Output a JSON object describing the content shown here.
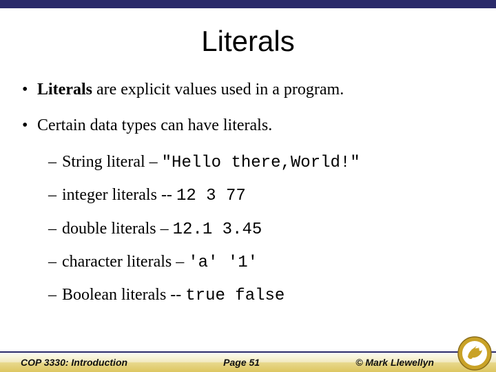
{
  "title": "Literals",
  "bullets": {
    "b1_strong": "Literals",
    "b1_rest": " are explicit values used in a program.",
    "b2": "Certain data types can have literals.",
    "sub1_lead": "String literal – ",
    "sub1_code": "\"Hello there,World!\"",
    "sub2_lead": "integer literals --    ",
    "sub2_code": "12   3   77",
    "sub3_lead": "double literals –     ",
    "sub3_code": "12.1   3.45",
    "sub4_lead": "character literals –  ",
    "sub4_code": "'a'    '1'",
    "sub5_lead": "Boolean literals  --   ",
    "sub5_code": "true   false"
  },
  "footer": {
    "left": "COP 3330: Introduction",
    "center": "Page 51",
    "right": "© Mark Llewellyn"
  },
  "logo_name": "ucf-pegasus-logo"
}
